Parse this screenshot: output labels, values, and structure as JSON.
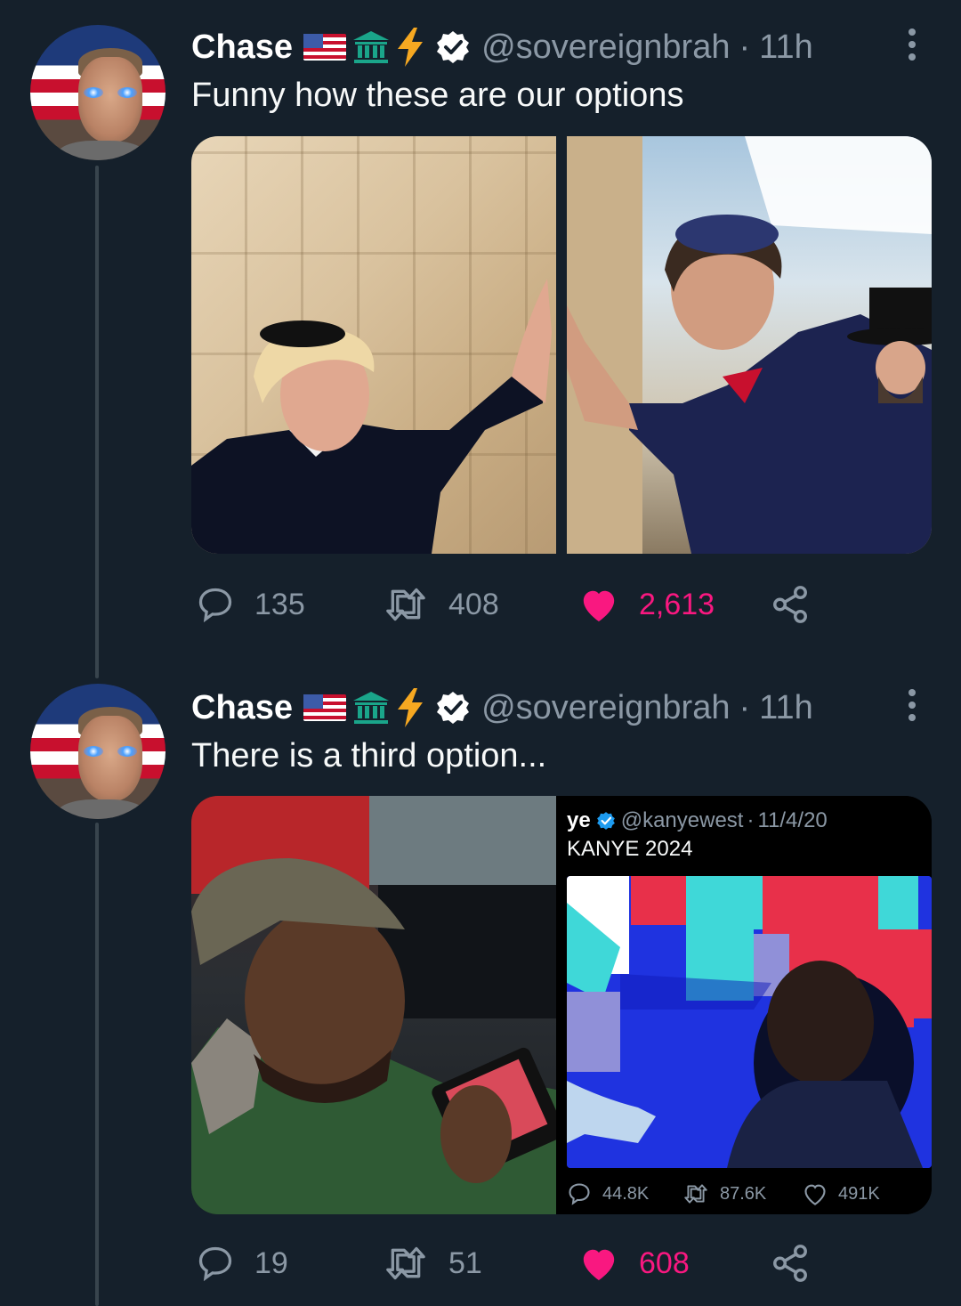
{
  "tweets": [
    {
      "name": "Chase",
      "handle": "@sovereignbrah",
      "separator": "·",
      "time": "11h",
      "text": "Funny how these are our options",
      "replies": "135",
      "retweets": "408",
      "likes": "2,613"
    },
    {
      "name": "Chase",
      "handle": "@sovereignbrah",
      "separator": "·",
      "time": "11h",
      "text": "There is a third option...",
      "replies": "19",
      "retweets": "51",
      "likes": "608",
      "embed": {
        "name": "ye",
        "handle": "@kanyewest",
        "separator": "·",
        "date": "11/4/20",
        "text": "KANYE 2024",
        "replies": "44.8K",
        "retweets": "87.6K",
        "likes": "491K"
      }
    }
  ],
  "colors": {
    "background": "#15202b",
    "muted": "#8b98a5",
    "like": "#f91880",
    "verified": "#ffffff",
    "thread_line": "#38444d"
  },
  "icons": [
    "flag-usa-icon",
    "bank-building-icon",
    "lightning-bolt-icon",
    "verified-badge-icon",
    "more-options-icon",
    "reply-icon",
    "retweet-icon",
    "heart-icon",
    "share-icon"
  ]
}
